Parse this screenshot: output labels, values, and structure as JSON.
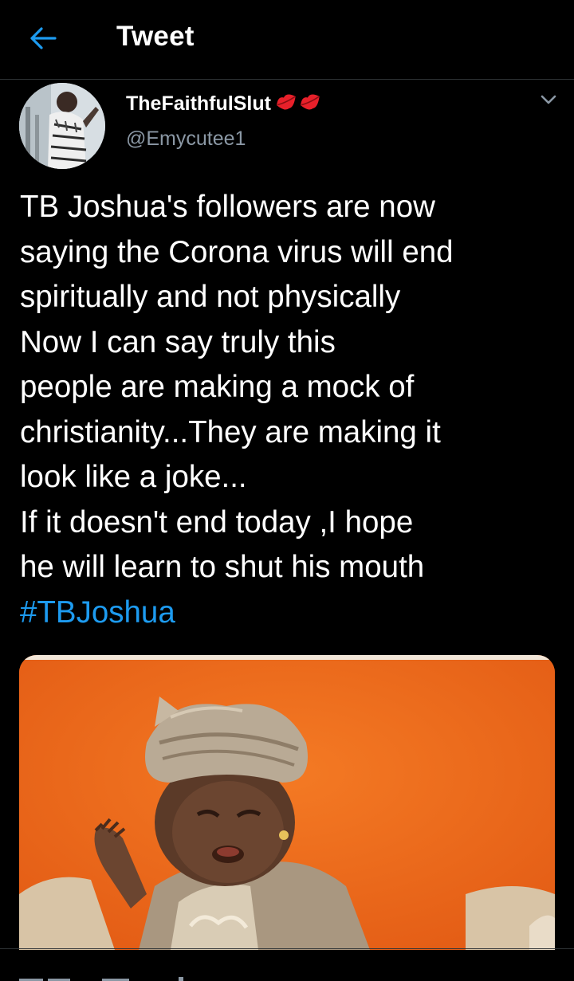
{
  "header": {
    "title": "Tweet",
    "back_icon": "arrow-left-icon",
    "accent_color": "#1d9bf0"
  },
  "author": {
    "display_name": "TheFaithfulSlut",
    "name_emoji": "lips-emoji-icon",
    "handle": "@Emycutee1",
    "avatar_icon": "user-avatar-photo"
  },
  "tweet": {
    "lines": [
      "TB Joshua's followers are now",
      "saying the Corona virus will end",
      "spiritually and not physically",
      "Now I can say truly this",
      "people are making a mock of",
      "christianity...They are making it",
      "look like a joke...",
      "If it doesn't end today ,I hope",
      "he will learn to shut his mouth"
    ],
    "hashtag": "#TBJoshua",
    "hashtag_color": "#1d9bf0",
    "media_description_icon": "crying-child-photo"
  },
  "colors": {
    "background": "#000000",
    "secondary_text": "#8b98a5",
    "divider": "#2f3336"
  }
}
